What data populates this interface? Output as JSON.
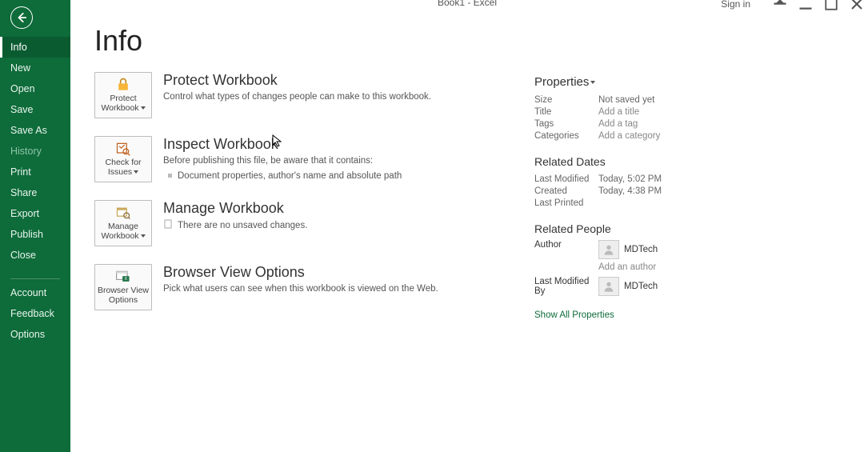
{
  "titlebar": {
    "doc": "Book1 - Excel",
    "signin": "Sign in"
  },
  "sidebar": {
    "items": [
      {
        "label": "Info",
        "active": true
      },
      {
        "label": "New"
      },
      {
        "label": "Open"
      },
      {
        "label": "Save"
      },
      {
        "label": "Save As"
      },
      {
        "label": "History",
        "disabled": true
      },
      {
        "label": "Print"
      },
      {
        "label": "Share"
      },
      {
        "label": "Export"
      },
      {
        "label": "Publish"
      },
      {
        "label": "Close"
      }
    ],
    "footer": [
      {
        "label": "Account"
      },
      {
        "label": "Feedback"
      },
      {
        "label": "Options"
      }
    ]
  },
  "page": {
    "title": "Info",
    "cards": {
      "protect": {
        "tile_label": "Protect Workbook",
        "title": "Protect Workbook",
        "desc": "Control what types of changes people can make to this workbook."
      },
      "inspect": {
        "tile_label": "Check for Issues",
        "title": "Inspect Workbook",
        "desc": "Before publishing this file, be aware that it contains:",
        "item1": "Document properties, author's name and absolute path"
      },
      "manage": {
        "tile_label": "Manage Workbook",
        "title": "Manage Workbook",
        "desc": "There are no unsaved changes."
      },
      "browser": {
        "tile_label": "Browser View Options",
        "title": "Browser View Options",
        "desc": "Pick what users can see when this workbook is viewed on the Web."
      }
    },
    "properties": {
      "heading": "Properties",
      "size_label": "Size",
      "size_value": "Not saved yet",
      "title_label": "Title",
      "title_value": "Add a title",
      "tags_label": "Tags",
      "tags_value": "Add a tag",
      "categories_label": "Categories",
      "categories_value": "Add a category"
    },
    "related_dates": {
      "heading": "Related Dates",
      "last_modified_label": "Last Modified",
      "last_modified_value": "Today, 5:02 PM",
      "created_label": "Created",
      "created_value": "Today, 4:38 PM",
      "last_printed_label": "Last Printed",
      "last_printed_value": ""
    },
    "related_people": {
      "heading": "Related People",
      "author_label": "Author",
      "author_name": "MDTech",
      "add_author": "Add an author",
      "modified_by_label": "Last Modified By",
      "modified_by_name": "MDTech"
    },
    "show_all": "Show All Properties"
  }
}
